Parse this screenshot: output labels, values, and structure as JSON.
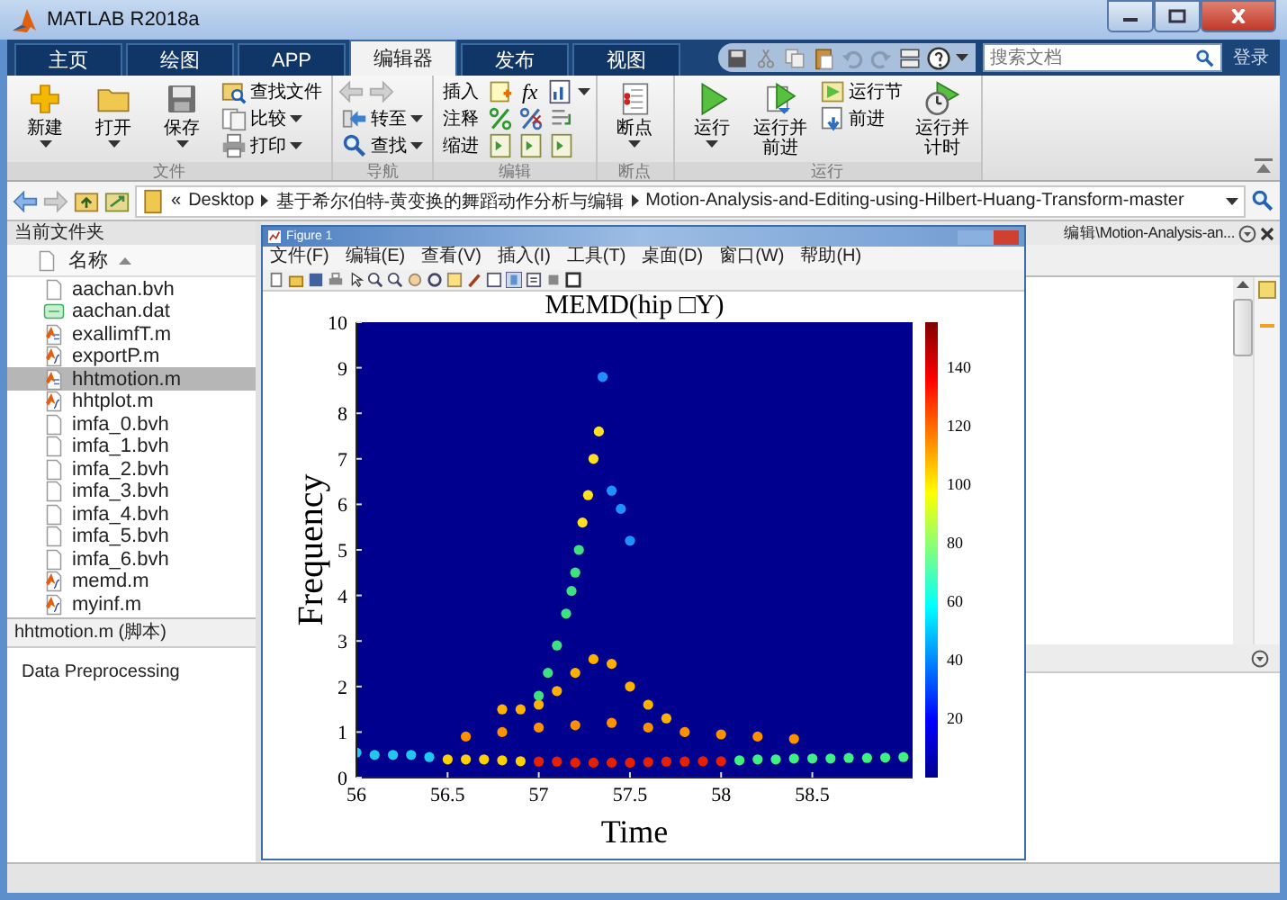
{
  "app": {
    "title": "MATLAB R2018a"
  },
  "tabs": [
    {
      "label": "主页",
      "selected": false
    },
    {
      "label": "绘图",
      "selected": false
    },
    {
      "label": "APP",
      "selected": false
    },
    {
      "label": "编辑器",
      "selected": true
    },
    {
      "label": "发布",
      "selected": false
    },
    {
      "label": "视图",
      "selected": false
    }
  ],
  "search": {
    "placeholder": "搜索文档"
  },
  "login": "登录",
  "ribbon": {
    "file": {
      "label": "文件",
      "large": [
        "新建",
        "打开",
        "保存"
      ],
      "small": [
        "查找文件",
        "比较",
        "打印"
      ]
    },
    "navigate": {
      "label": "导航",
      "small": [
        "转至",
        "查找"
      ]
    },
    "edit": {
      "label": "编辑",
      "rows": [
        "插入",
        "注释",
        "缩进"
      ],
      "function_button": "fx"
    },
    "breakpoints": {
      "label": "断点",
      "large": [
        "断点"
      ]
    },
    "run": {
      "label": "运行",
      "large": [
        "运行",
        "运行并前进"
      ],
      "small": [
        "运行节",
        "前进"
      ],
      "timed": "运行并计时"
    }
  },
  "address": {
    "overflow": "«",
    "path": [
      "Desktop",
      "基于希尔伯特-黄变换的舞蹈动作分析与编辑",
      "Motion-Analysis-and-Editing-using-Hilbert-Huang-Transform-master"
    ]
  },
  "current_folder": {
    "title": "当前文件夹",
    "column": "名称",
    "files": [
      {
        "name": "aachan.bvh",
        "kind": "text",
        "selected": false
      },
      {
        "name": "aachan.dat",
        "kind": "data",
        "selected": false
      },
      {
        "name": "exallimfT.m",
        "kind": "script",
        "selected": false
      },
      {
        "name": "exportP.m",
        "kind": "function",
        "selected": false
      },
      {
        "name": "hhtmotion.m",
        "kind": "script",
        "selected": true
      },
      {
        "name": "hhtplot.m",
        "kind": "function",
        "selected": false
      },
      {
        "name": "imfa_0.bvh",
        "kind": "text",
        "selected": false
      },
      {
        "name": "imfa_1.bvh",
        "kind": "text",
        "selected": false
      },
      {
        "name": "imfa_2.bvh",
        "kind": "text",
        "selected": false
      },
      {
        "name": "imfa_3.bvh",
        "kind": "text",
        "selected": false
      },
      {
        "name": "imfa_4.bvh",
        "kind": "text",
        "selected": false
      },
      {
        "name": "imfa_5.bvh",
        "kind": "text",
        "selected": false
      },
      {
        "name": "imfa_6.bvh",
        "kind": "text",
        "selected": false
      },
      {
        "name": "memd.m",
        "kind": "function",
        "selected": false
      },
      {
        "name": "myinf.m",
        "kind": "function",
        "selected": false
      }
    ]
  },
  "details": {
    "title": "hhtmotion.m (脚本)",
    "text": "Data Preprocessing"
  },
  "editor": {
    "tab_title": "编辑\\Motion-Analysis-an..."
  },
  "figure": {
    "title": "Figure 1",
    "menu": [
      "文件(F)",
      "编辑(E)",
      "查看(V)",
      "插入(I)",
      "工具(T)",
      "桌面(D)",
      "窗口(W)",
      "帮助(H)"
    ],
    "colorbar_labels": [
      "140",
      "120",
      "100",
      "80",
      "60",
      "40",
      "20"
    ],
    "chart_data": {
      "type": "scatter",
      "title": "MEMD(hip □Y)",
      "xlabel": "Time",
      "ylabel": "Frequency",
      "xlim": [
        56,
        59.05
      ],
      "ylim": [
        0,
        10
      ],
      "xticks": [
        56,
        56.5,
        57,
        57.5,
        58,
        58.5
      ],
      "yticks": [
        0,
        1,
        2,
        3,
        4,
        5,
        6,
        7,
        8,
        9,
        10
      ],
      "series": [
        {
          "color": "#20c8f0",
          "x": [
            56,
            56.1,
            56.2,
            56.3,
            56.4
          ],
          "values": [
            0.55,
            0.5,
            0.5,
            0.5,
            0.45
          ]
        },
        {
          "color": "#ffd000",
          "x": [
            56.5,
            56.6,
            56.7,
            56.8,
            56.9
          ],
          "values": [
            0.4,
            0.4,
            0.4,
            0.38,
            0.36
          ]
        },
        {
          "color": "#e82000",
          "x": [
            57,
            57.1,
            57.2,
            57.3,
            57.4,
            57.5,
            57.6,
            57.7,
            57.8,
            57.9,
            58
          ],
          "values": [
            0.35,
            0.35,
            0.33,
            0.33,
            0.33,
            0.33,
            0.34,
            0.35,
            0.35,
            0.36,
            0.36
          ]
        },
        {
          "color": "#40f080",
          "x": [
            58.1,
            58.2,
            58.3,
            58.4,
            58.5,
            58.6,
            58.7,
            58.8,
            58.9,
            59
          ],
          "values": [
            0.38,
            0.4,
            0.4,
            0.42,
            0.42,
            0.42,
            0.43,
            0.43,
            0.44,
            0.45
          ]
        },
        {
          "color": "#ff9000",
          "x": [
            56.6,
            56.8,
            57,
            57.2,
            57.4,
            57.6,
            57.8,
            58,
            58.2,
            58.4
          ],
          "values": [
            0.9,
            1,
            1.1,
            1.15,
            1.2,
            1.1,
            1,
            0.95,
            0.9,
            0.85
          ]
        },
        {
          "color": "#ffb000",
          "x": [
            56.8,
            56.9,
            57,
            57.1,
            57.2,
            57.3,
            57.4,
            57.5,
            57.6,
            57.7
          ],
          "values": [
            1.5,
            1.5,
            1.6,
            1.9,
            2.3,
            2.6,
            2.5,
            2,
            1.6,
            1.3
          ]
        },
        {
          "color": "#40e080",
          "x": [
            57,
            57.05,
            57.1,
            57.15,
            57.18,
            57.2,
            57.22
          ],
          "values": [
            1.8,
            2.3,
            2.9,
            3.6,
            4.1,
            4.5,
            5
          ]
        },
        {
          "color": "#ffe020",
          "x": [
            57.24,
            57.27,
            57.3,
            57.33
          ],
          "values": [
            5.6,
            6.2,
            7,
            7.6
          ]
        },
        {
          "color": "#2090ff",
          "x": [
            57.35,
            57.4,
            57.45,
            57.5
          ],
          "values": [
            8.8,
            6.3,
            5.9,
            5.2
          ]
        }
      ]
    }
  }
}
